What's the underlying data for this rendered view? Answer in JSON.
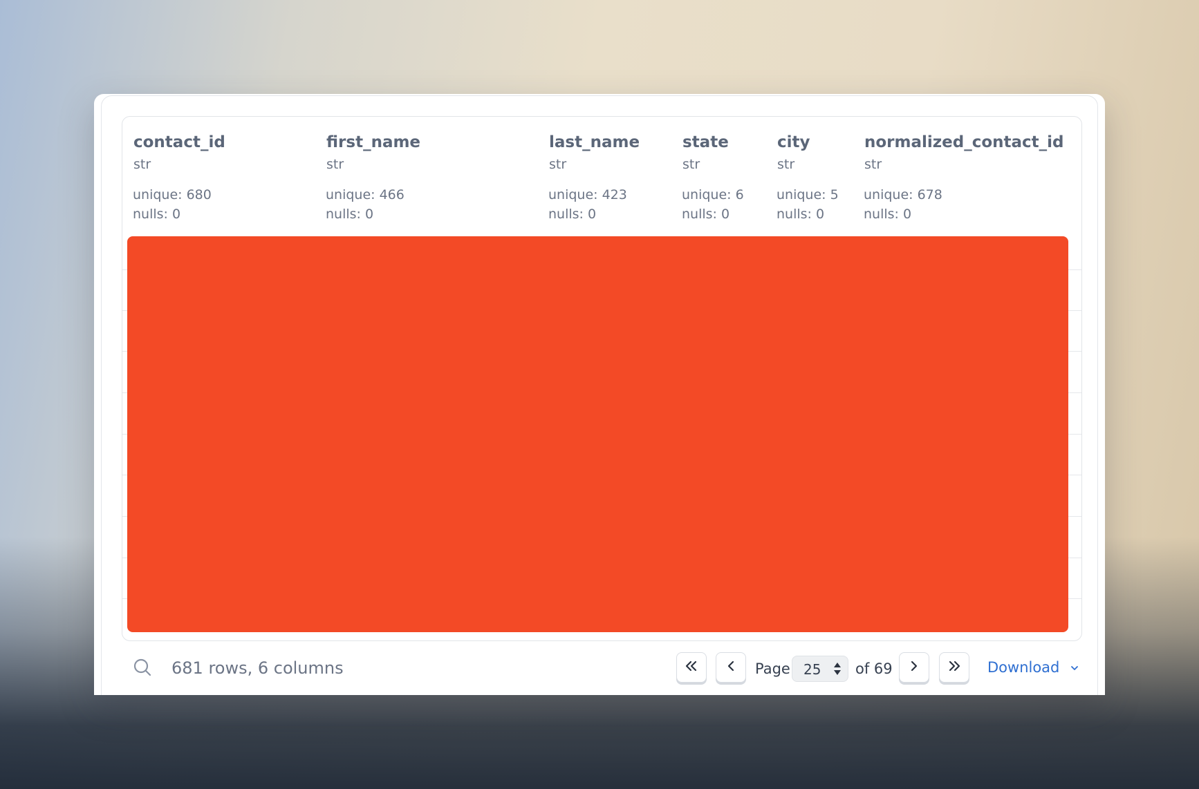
{
  "table": {
    "columns": [
      {
        "name": "contact_id",
        "type": "str",
        "unique": "unique: 680",
        "nulls": "nulls: 0"
      },
      {
        "name": "first_name",
        "type": "str",
        "unique": "unique: 466",
        "nulls": "nulls: 0"
      },
      {
        "name": "last_name",
        "type": "str",
        "unique": "unique: 423",
        "nulls": "nulls: 0"
      },
      {
        "name": "state",
        "type": "str",
        "unique": "unique: 6",
        "nulls": "nulls: 0"
      },
      {
        "name": "city",
        "type": "str",
        "unique": "unique: 5",
        "nulls": "nulls: 0"
      },
      {
        "name": "normalized_contact_id",
        "type": "str",
        "unique": "unique: 678",
        "nulls": "nulls: 0"
      }
    ],
    "redaction_color": "#f34a26"
  },
  "footer": {
    "search_icon": "search-icon",
    "summary": "681 rows, 6 columns",
    "pagination": {
      "page_label": "Page",
      "current_page": "25",
      "of_label": "of 69",
      "first_icon": "double-chevron-left-icon",
      "prev_icon": "chevron-left-icon",
      "next_icon": "chevron-right-icon",
      "last_icon": "double-chevron-right-icon"
    },
    "download_label": "Download"
  },
  "colors": {
    "accent": "#2f6fd1",
    "header_text": "#5b6678",
    "muted_text": "#6b7485"
  }
}
